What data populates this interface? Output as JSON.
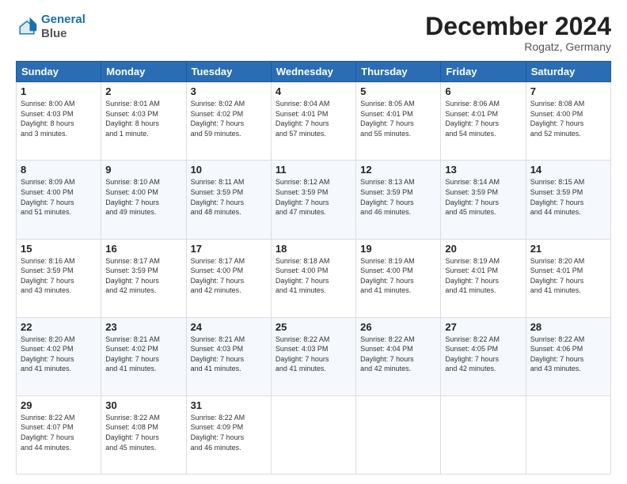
{
  "header": {
    "logo_line1": "General",
    "logo_line2": "Blue",
    "month_title": "December 2024",
    "subtitle": "Rogatz, Germany"
  },
  "days_of_week": [
    "Sunday",
    "Monday",
    "Tuesday",
    "Wednesday",
    "Thursday",
    "Friday",
    "Saturday"
  ],
  "weeks": [
    [
      {
        "day": 1,
        "info": "Sunrise: 8:00 AM\nSunset: 4:03 PM\nDaylight: 8 hours\nand 3 minutes."
      },
      {
        "day": 2,
        "info": "Sunrise: 8:01 AM\nSunset: 4:03 PM\nDaylight: 8 hours\nand 1 minute."
      },
      {
        "day": 3,
        "info": "Sunrise: 8:02 AM\nSunset: 4:02 PM\nDaylight: 7 hours\nand 59 minutes."
      },
      {
        "day": 4,
        "info": "Sunrise: 8:04 AM\nSunset: 4:01 PM\nDaylight: 7 hours\nand 57 minutes."
      },
      {
        "day": 5,
        "info": "Sunrise: 8:05 AM\nSunset: 4:01 PM\nDaylight: 7 hours\nand 55 minutes."
      },
      {
        "day": 6,
        "info": "Sunrise: 8:06 AM\nSunset: 4:01 PM\nDaylight: 7 hours\nand 54 minutes."
      },
      {
        "day": 7,
        "info": "Sunrise: 8:08 AM\nSunset: 4:00 PM\nDaylight: 7 hours\nand 52 minutes."
      }
    ],
    [
      {
        "day": 8,
        "info": "Sunrise: 8:09 AM\nSunset: 4:00 PM\nDaylight: 7 hours\nand 51 minutes."
      },
      {
        "day": 9,
        "info": "Sunrise: 8:10 AM\nSunset: 4:00 PM\nDaylight: 7 hours\nand 49 minutes."
      },
      {
        "day": 10,
        "info": "Sunrise: 8:11 AM\nSunset: 3:59 PM\nDaylight: 7 hours\nand 48 minutes."
      },
      {
        "day": 11,
        "info": "Sunrise: 8:12 AM\nSunset: 3:59 PM\nDaylight: 7 hours\nand 47 minutes."
      },
      {
        "day": 12,
        "info": "Sunrise: 8:13 AM\nSunset: 3:59 PM\nDaylight: 7 hours\nand 46 minutes."
      },
      {
        "day": 13,
        "info": "Sunrise: 8:14 AM\nSunset: 3:59 PM\nDaylight: 7 hours\nand 45 minutes."
      },
      {
        "day": 14,
        "info": "Sunrise: 8:15 AM\nSunset: 3:59 PM\nDaylight: 7 hours\nand 44 minutes."
      }
    ],
    [
      {
        "day": 15,
        "info": "Sunrise: 8:16 AM\nSunset: 3:59 PM\nDaylight: 7 hours\nand 43 minutes."
      },
      {
        "day": 16,
        "info": "Sunrise: 8:17 AM\nSunset: 3:59 PM\nDaylight: 7 hours\nand 42 minutes."
      },
      {
        "day": 17,
        "info": "Sunrise: 8:17 AM\nSunset: 4:00 PM\nDaylight: 7 hours\nand 42 minutes."
      },
      {
        "day": 18,
        "info": "Sunrise: 8:18 AM\nSunset: 4:00 PM\nDaylight: 7 hours\nand 41 minutes."
      },
      {
        "day": 19,
        "info": "Sunrise: 8:19 AM\nSunset: 4:00 PM\nDaylight: 7 hours\nand 41 minutes."
      },
      {
        "day": 20,
        "info": "Sunrise: 8:19 AM\nSunset: 4:01 PM\nDaylight: 7 hours\nand 41 minutes."
      },
      {
        "day": 21,
        "info": "Sunrise: 8:20 AM\nSunset: 4:01 PM\nDaylight: 7 hours\nand 41 minutes."
      }
    ],
    [
      {
        "day": 22,
        "info": "Sunrise: 8:20 AM\nSunset: 4:02 PM\nDaylight: 7 hours\nand 41 minutes."
      },
      {
        "day": 23,
        "info": "Sunrise: 8:21 AM\nSunset: 4:02 PM\nDaylight: 7 hours\nand 41 minutes."
      },
      {
        "day": 24,
        "info": "Sunrise: 8:21 AM\nSunset: 4:03 PM\nDaylight: 7 hours\nand 41 minutes."
      },
      {
        "day": 25,
        "info": "Sunrise: 8:22 AM\nSunset: 4:03 PM\nDaylight: 7 hours\nand 41 minutes."
      },
      {
        "day": 26,
        "info": "Sunrise: 8:22 AM\nSunset: 4:04 PM\nDaylight: 7 hours\nand 42 minutes."
      },
      {
        "day": 27,
        "info": "Sunrise: 8:22 AM\nSunset: 4:05 PM\nDaylight: 7 hours\nand 42 minutes."
      },
      {
        "day": 28,
        "info": "Sunrise: 8:22 AM\nSunset: 4:06 PM\nDaylight: 7 hours\nand 43 minutes."
      }
    ],
    [
      {
        "day": 29,
        "info": "Sunrise: 8:22 AM\nSunset: 4:07 PM\nDaylight: 7 hours\nand 44 minutes."
      },
      {
        "day": 30,
        "info": "Sunrise: 8:22 AM\nSunset: 4:08 PM\nDaylight: 7 hours\nand 45 minutes."
      },
      {
        "day": 31,
        "info": "Sunrise: 8:22 AM\nSunset: 4:09 PM\nDaylight: 7 hours\nand 46 minutes."
      },
      {
        "day": null,
        "info": ""
      },
      {
        "day": null,
        "info": ""
      },
      {
        "day": null,
        "info": ""
      },
      {
        "day": null,
        "info": ""
      }
    ]
  ]
}
